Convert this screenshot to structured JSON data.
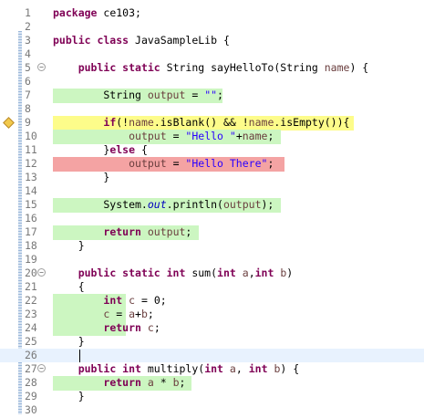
{
  "editor": {
    "line_numbers": [
      "1",
      "2",
      "3",
      "4",
      "5",
      "6",
      "7",
      "8",
      "9",
      "10",
      "11",
      "12",
      "13",
      "14",
      "15",
      "16",
      "17",
      "18",
      "19",
      "20",
      "21",
      "22",
      "23",
      "24",
      "25",
      "26",
      "27",
      "28",
      "29",
      "30"
    ],
    "lines": [
      {
        "n": "1",
        "html": "<span class=\"kw\">package</span> ce103;"
      },
      {
        "n": "2",
        "html": ""
      },
      {
        "n": "3",
        "html": "<span class=\"kw\">public class</span> JavaSampleLib {"
      },
      {
        "n": "4",
        "html": ""
      },
      {
        "n": "5",
        "html": "    <span class=\"kw\">public static</span> String sayHelloTo(String <span class=\"var\">name</span>) {"
      },
      {
        "n": "6",
        "html": ""
      },
      {
        "n": "7",
        "html": "        String <span class=\"var\">output</span> = <span class=\"str\">\"\"</span>;"
      },
      {
        "n": "8",
        "html": ""
      },
      {
        "n": "9",
        "html": "        <span class=\"kw\">if</span>(!<span class=\"var\">name</span>.isBlank() &amp;&amp; !<span class=\"var\">name</span>.isEmpty()){"
      },
      {
        "n": "10",
        "html": "            <span class=\"var\">output</span> = <span class=\"str\">\"Hello \"</span>+<span class=\"var\">name</span>;"
      },
      {
        "n": "11",
        "html": "        }<span class=\"kw\">else</span> {"
      },
      {
        "n": "12",
        "html": "            <span class=\"var\">output</span> = <span class=\"str\">\"Hello There\"</span>;"
      },
      {
        "n": "13",
        "html": "        }"
      },
      {
        "n": "14",
        "html": ""
      },
      {
        "n": "15",
        "html": "        System.<span class=\"fld\">out</span>.println(<span class=\"var\">output</span>);"
      },
      {
        "n": "16",
        "html": ""
      },
      {
        "n": "17",
        "html": "        <span class=\"kw\">return</span> <span class=\"var\">output</span>;"
      },
      {
        "n": "18",
        "html": "    }"
      },
      {
        "n": "19",
        "html": ""
      },
      {
        "n": "20",
        "html": "    <span class=\"kw\">public static int</span> sum(<span class=\"kw\">int</span> <span class=\"var\">a</span>,<span class=\"kw\">int</span> <span class=\"var\">b</span>)"
      },
      {
        "n": "21",
        "html": "    {"
      },
      {
        "n": "22",
        "html": "        <span class=\"kw\">int</span> <span class=\"var\">c</span> = 0;"
      },
      {
        "n": "23",
        "html": "        <span class=\"var\">c</span> = <span class=\"var\">a</span>+<span class=\"var\">b</span>;"
      },
      {
        "n": "24",
        "html": "        <span class=\"kw\">return</span> <span class=\"var\">c</span>;"
      },
      {
        "n": "25",
        "html": "    }"
      },
      {
        "n": "26",
        "html": ""
      },
      {
        "n": "27",
        "html": "    <span class=\"kw\">public int</span> multiply(<span class=\"kw\">int</span> <span class=\"var\">a</span>, <span class=\"kw\">int</span> <span class=\"var\">b</span>) {"
      },
      {
        "n": "28",
        "html": "        <span class=\"kw\">return</span> <span class=\"var\">a</span> * <span class=\"var\">b</span>;"
      },
      {
        "n": "29",
        "html": "    }"
      },
      {
        "n": "30",
        "html": ""
      }
    ],
    "coverage": {
      "fully_covered": [
        "7",
        "10",
        "15",
        "17",
        "22",
        "23",
        "24",
        "28"
      ],
      "partially_covered": [
        "9"
      ],
      "not_covered": [
        "12"
      ]
    },
    "colors": {
      "covered": "#ccf6c1",
      "partial": "#fdfc8a",
      "missed": "#f4a3a3",
      "current_line": "#e8f2fe"
    },
    "folding_lines": [
      "5",
      "20",
      "27"
    ],
    "current_line": "26"
  }
}
